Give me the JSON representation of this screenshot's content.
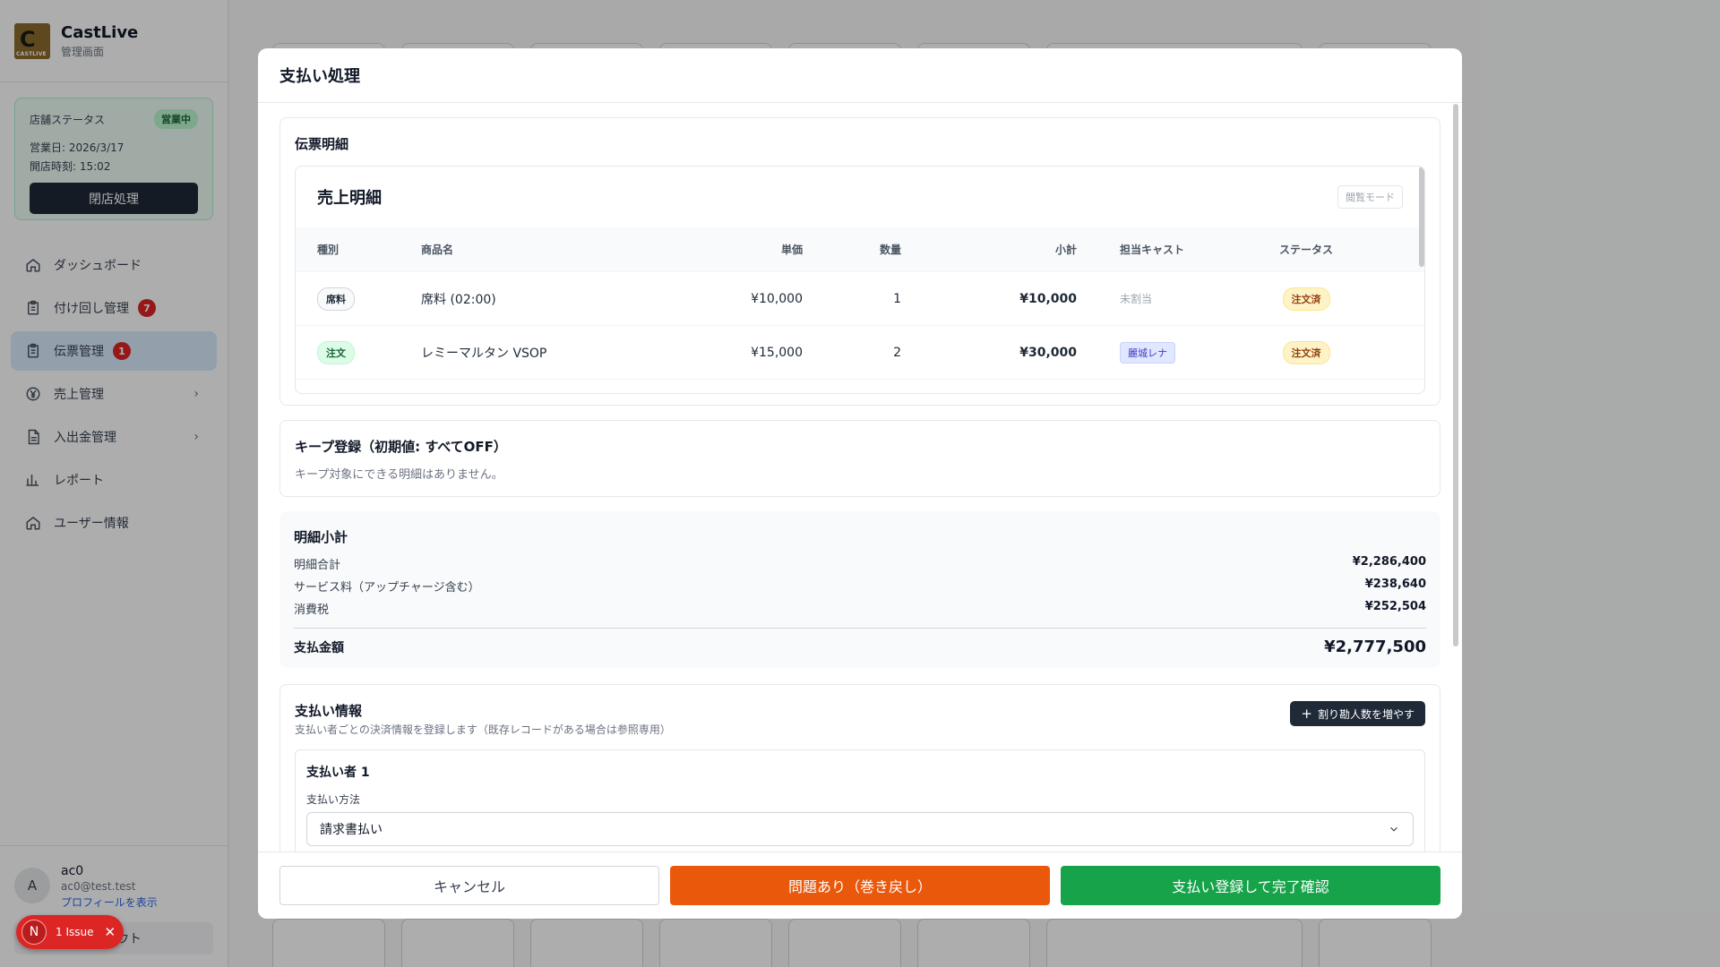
{
  "app": {
    "name": "CastLive",
    "subtitle": "管理画面",
    "logo_text": "CASTLIVE"
  },
  "store_status": {
    "label": "店舗ステータス",
    "badge": "営業中",
    "business_date": "営業日: 2026/3/17",
    "open_time": "開店時刻: 15:02",
    "close_button": "閉店処理"
  },
  "sidebar": {
    "items": [
      {
        "label": "ダッシュボード",
        "icon": "home-icon"
      },
      {
        "label": "付け回し管理",
        "icon": "clipboard-icon",
        "badge": "7"
      },
      {
        "label": "伝票管理",
        "icon": "clipboard-icon",
        "badge": "1",
        "active": true
      },
      {
        "label": "売上管理",
        "icon": "yen-icon",
        "chevron": true
      },
      {
        "label": "入出金管理",
        "icon": "document-icon",
        "chevron": true
      },
      {
        "label": "レポート",
        "icon": "bar-chart-icon"
      },
      {
        "label": "ユーザー情報",
        "icon": "home-icon"
      }
    ]
  },
  "user": {
    "avatar": "A",
    "name": "ac0",
    "email": "ac0@test.test",
    "profile_link": "プロフィールを表示",
    "logout_partial": "ウト"
  },
  "issue": {
    "letter": "N",
    "text": "1 Issue",
    "close": "✕"
  },
  "modal": {
    "title": "支払い処理",
    "slip_section": "伝票明細",
    "sales": {
      "title": "売上明細",
      "mode": "閲覧モード",
      "columns": [
        "種別",
        "商品名",
        "単価",
        "数量",
        "小計",
        "担当キャスト",
        "ステータス"
      ],
      "rows": [
        {
          "type": "席料",
          "product": "席料 (02:00)",
          "unit_price": "¥10,000",
          "qty": "1",
          "subtotal": "¥10,000",
          "cast": "未割当",
          "status": "注文済"
        },
        {
          "type": "注文",
          "product": "レミーマルタン VSOP",
          "unit_price": "¥15,000",
          "qty": "2",
          "subtotal": "¥30,000",
          "cast": "麗城レナ",
          "status": "注文済"
        }
      ]
    },
    "keep": {
      "title": "キープ登録（初期値: すべてOFF）",
      "message": "キープ対象にできる明細はありません。"
    },
    "subtotal": {
      "title": "明細小計",
      "items": [
        {
          "label": "明細合計",
          "value": "¥2,286,400"
        },
        {
          "label": "サービス料（アップチャージ含む）",
          "value": "¥238,640"
        },
        {
          "label": "消費税",
          "value": "¥252,504"
        }
      ],
      "total_label": "支払金額",
      "total_value": "¥2,777,500"
    },
    "payment": {
      "title": "支払い情報",
      "description": "支払い者ごとの決済情報を登録します（既存レコードがある場合は参照専用）",
      "add_button": "割り勘人数を増やす",
      "payer_title": "支払い者 1",
      "method_label": "支払い方法",
      "method_value": "請求書払い"
    },
    "footer": {
      "cancel": "キャンセル",
      "issue": "問題あり（巻き戻し）",
      "confirm": "支払い登録して完了確認"
    }
  }
}
